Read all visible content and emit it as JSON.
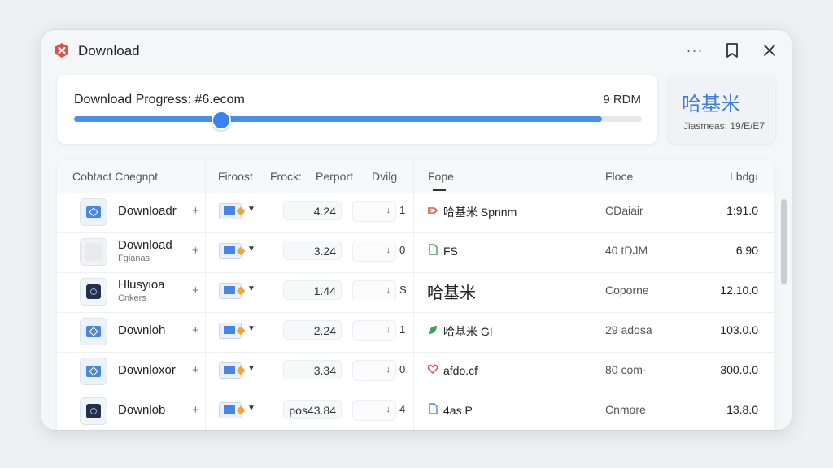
{
  "window": {
    "title": "Download",
    "more_label": "···"
  },
  "progress": {
    "label": "Download Progress: #6.ecom",
    "right_value": "9 RDM",
    "fraction": 0.26,
    "fill_fraction": 0.93
  },
  "side_card": {
    "title": "哈基米",
    "subtitle": "Jiasmeas: 19/E/E7"
  },
  "table": {
    "headers": {
      "contact": "Cobtact Cnegnpt",
      "firoost": "Firoost",
      "frock": "Frock:",
      "perport": "Perport",
      "dvilg": "Dvilg",
      "fope": "Fope",
      "floce": "Floce",
      "lbdg": "Lbdgı"
    },
    "rows": [
      {
        "name": "Downloadr",
        "sub": "",
        "value": "4.24",
        "digit": "1",
        "fope": "哈基米 Spnnm",
        "fope_icon": "tag",
        "floce": "CDaiair",
        "lbdg": "1:91.0"
      },
      {
        "name": "Download",
        "sub": "Fgianas",
        "value": "3.24",
        "digit": "0",
        "fope": "FS",
        "fope_icon": "doc-plus",
        "floce": "40 tDJM",
        "lbdg": "6.90"
      },
      {
        "name": "Hlusyioa",
        "sub": "Cnkers",
        "value": "1.44",
        "digit": "S",
        "fope": "哈基米",
        "fope_icon": "",
        "floce": "Coporne",
        "lbdg": "12.10.0"
      },
      {
        "name": "Downloh",
        "sub": "",
        "value": "2.24",
        "digit": "1",
        "fope": "哈基米 GI",
        "fope_icon": "leaf",
        "floce": "29 adosa",
        "lbdg": "103.0.0"
      },
      {
        "name": "Downloxor",
        "sub": "",
        "value": "3.34",
        "digit": "0",
        "fope": "afdo.cf",
        "fope_icon": "heart",
        "floce": "80 com·",
        "lbdg": "300.0.0"
      },
      {
        "name": "Downlob",
        "sub": "",
        "value": "pos43.84",
        "digit": "4",
        "fope": "4as P",
        "fope_icon": "doc",
        "floce": "Cnmore",
        "lbdg": "13.8.0"
      }
    ]
  },
  "colors": {
    "accent": "#3b82f0",
    "fill": "#4a8ef0",
    "brand_red": "#e0504a"
  }
}
